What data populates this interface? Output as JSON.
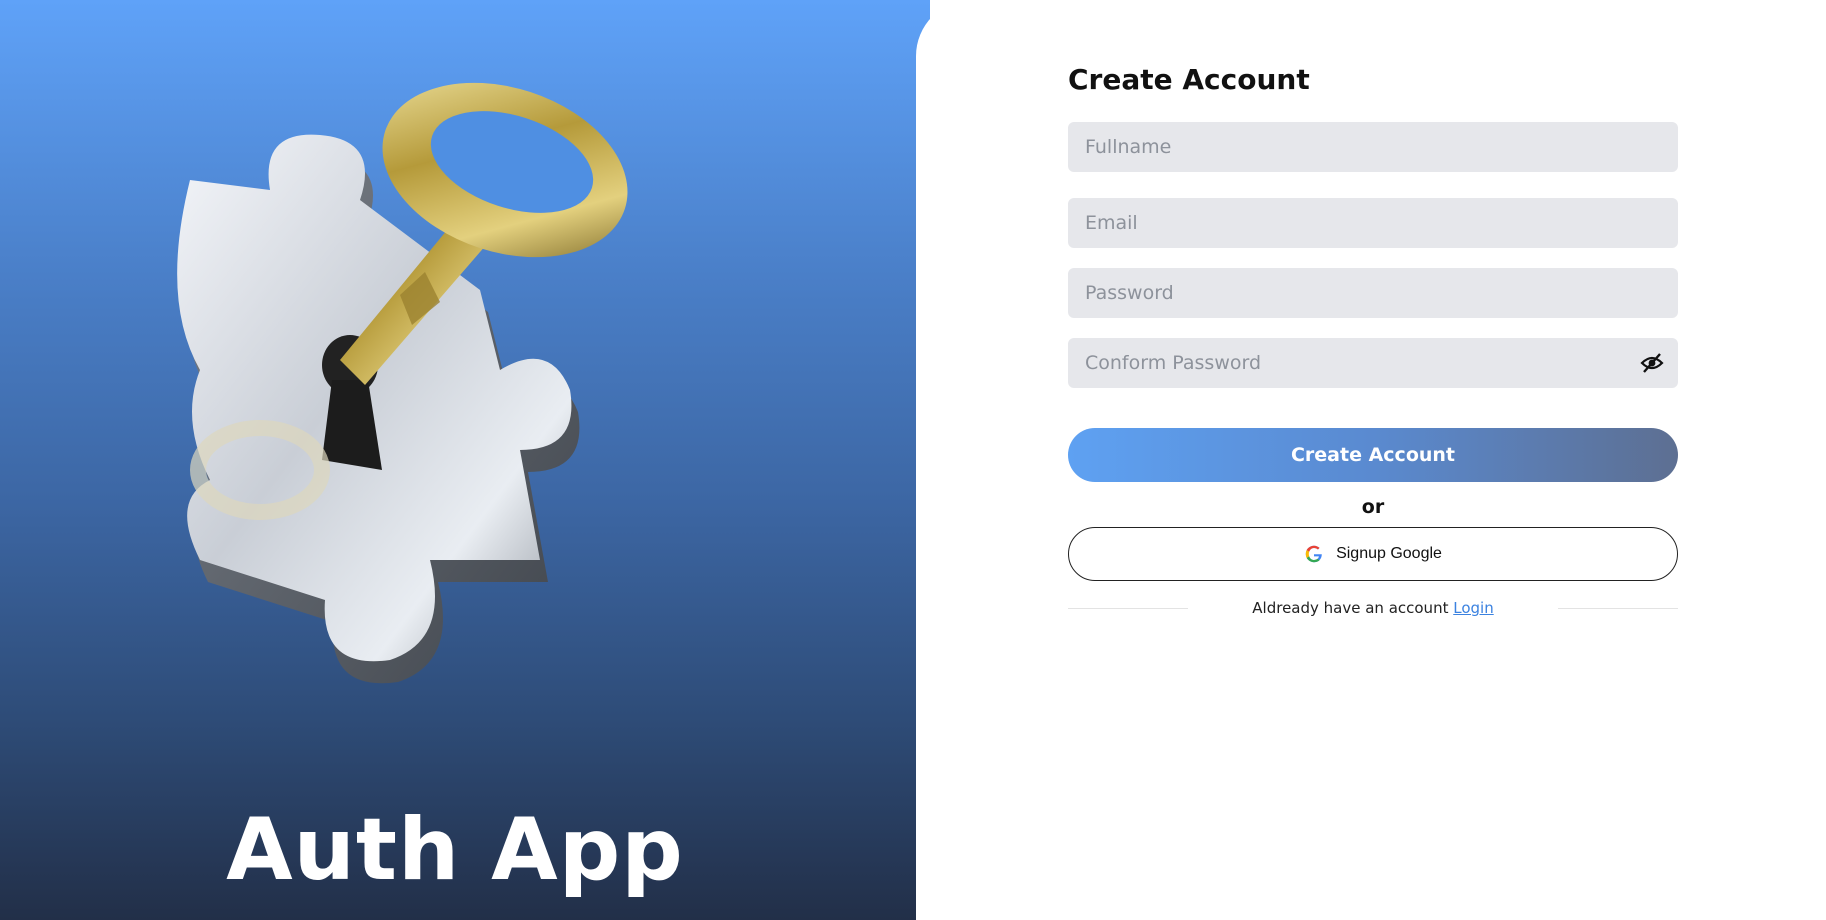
{
  "brand": {
    "title": "Auth App"
  },
  "form": {
    "title": "Create Account",
    "fields": [
      {
        "placeholder": "Fullname",
        "value": ""
      },
      {
        "placeholder": "Email",
        "value": ""
      },
      {
        "placeholder": "Password",
        "value": ""
      },
      {
        "placeholder": "Conform Password",
        "value": ""
      }
    ],
    "submit_label": "Create Account",
    "divider_text": "or",
    "google_label": "Signup Google",
    "footer_text": "Aldready have an account",
    "login_label": "Login"
  },
  "colors": {
    "panel_top": "#5fa2f8",
    "panel_bottom": "#222f48",
    "field_bg": "#e6e7eb",
    "button_start": "#5ea1f2",
    "button_end": "#5d6f92",
    "link": "#3b82e0"
  },
  "icons": {
    "hero": "puzzle-key-illustration",
    "password_toggle": "eye-off-icon",
    "google": "google-icon"
  }
}
